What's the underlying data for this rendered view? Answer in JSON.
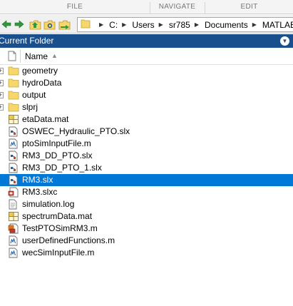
{
  "ribbon": {
    "sections": [
      "FILE",
      "NAVIGATE",
      "EDIT"
    ]
  },
  "address_bar": {
    "segments": [
      "C:",
      "Users",
      "sr785",
      "Documents",
      "MATLAB"
    ]
  },
  "panel": {
    "title": "Current Folder",
    "column_header": "Name",
    "sort": "ascending"
  },
  "files": [
    {
      "name": "geometry",
      "type": "folder",
      "icon": "folder-icon"
    },
    {
      "name": "hydroData",
      "type": "folder",
      "icon": "folder-icon"
    },
    {
      "name": "output",
      "type": "folder",
      "icon": "folder-icon"
    },
    {
      "name": "slprj",
      "type": "folder",
      "icon": "folder-icon"
    },
    {
      "name": "etaData.mat",
      "type": "mat",
      "icon": "mat-file-icon"
    },
    {
      "name": "OSWEC_Hydraulic_PTO.slx",
      "type": "slx",
      "icon": "simulink-model-icon"
    },
    {
      "name": "ptoSimInputFile.m",
      "type": "m",
      "icon": "m-file-icon"
    },
    {
      "name": "RM3_DD_PTO.slx",
      "type": "slx",
      "icon": "simulink-model-icon"
    },
    {
      "name": "RM3_DD_PTO_1.slx",
      "type": "slx",
      "icon": "simulink-model-icon"
    },
    {
      "name": "RM3.slx",
      "type": "slx",
      "icon": "simulink-model-icon",
      "selected": true
    },
    {
      "name": "RM3.slxc",
      "type": "slxc",
      "icon": "slxc-file-icon"
    },
    {
      "name": "simulation.log",
      "type": "log",
      "icon": "text-file-icon"
    },
    {
      "name": "spectrumData.mat",
      "type": "mat",
      "icon": "mat-file-icon"
    },
    {
      "name": "TestPTOSimRM3.m",
      "type": "class",
      "icon": "class-file-icon"
    },
    {
      "name": "userDefinedFunctions.m",
      "type": "m",
      "icon": "m-file-icon"
    },
    {
      "name": "wecSimInputFile.m",
      "type": "m",
      "icon": "m-file-icon"
    }
  ],
  "colors": {
    "panel_title_bg": "#1a4f8e",
    "selection_bg": "#0078d7",
    "folder_yellow": "#f7d66b"
  }
}
